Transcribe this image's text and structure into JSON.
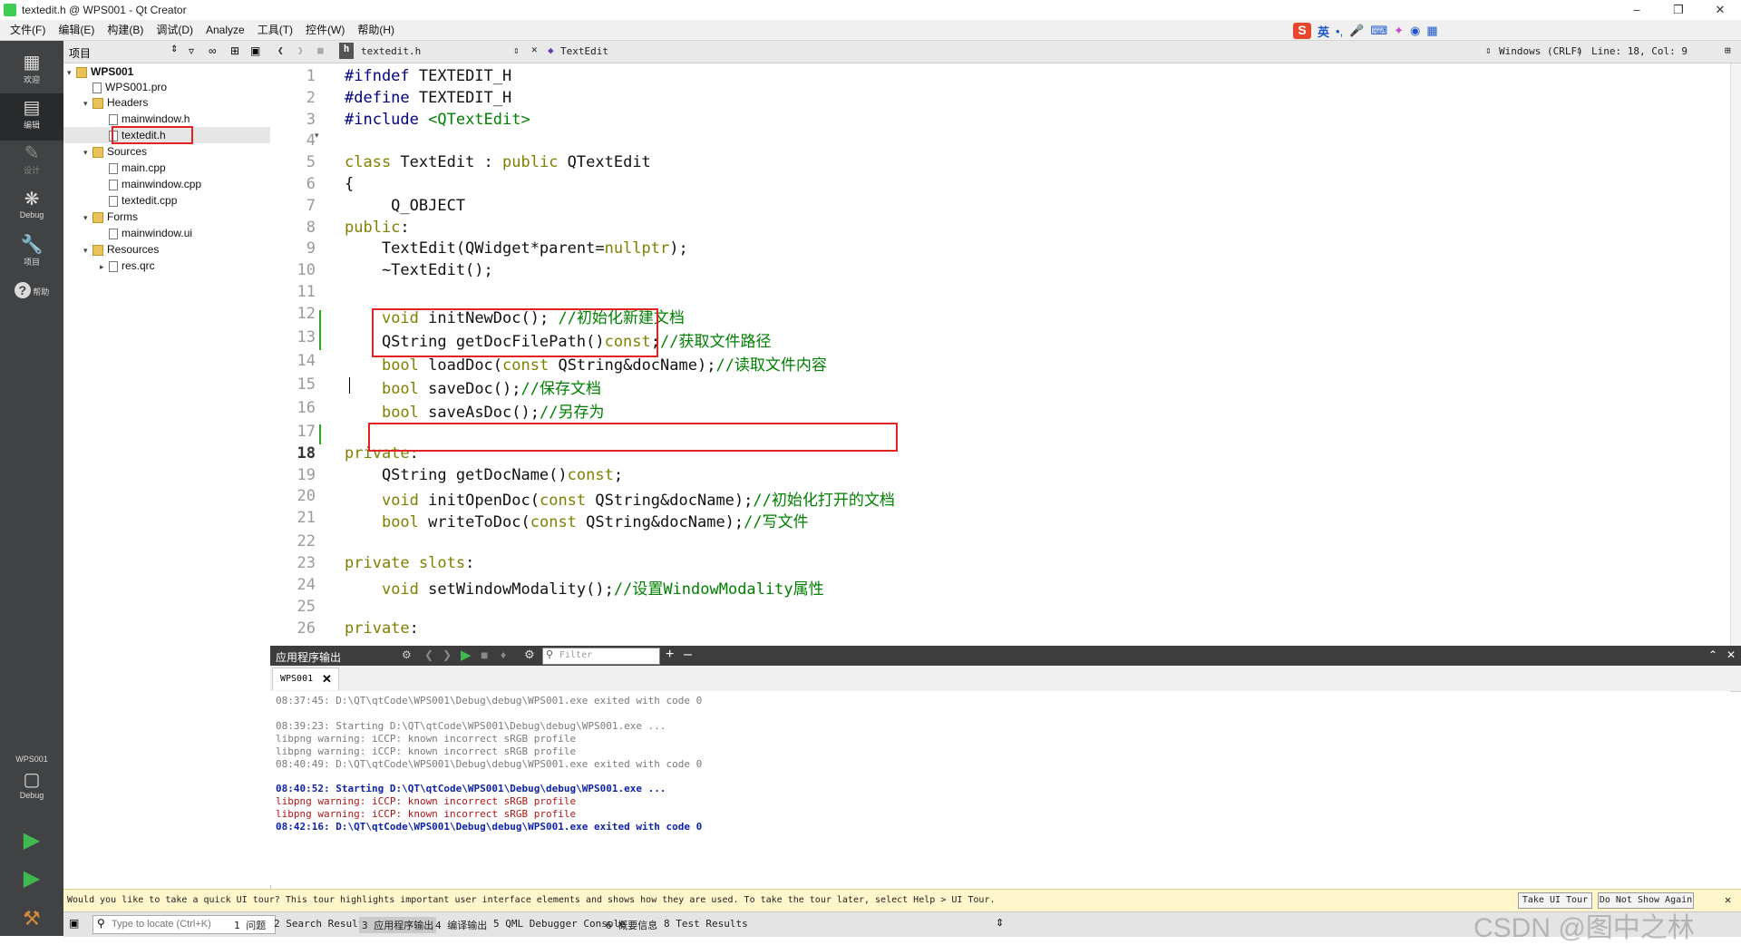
{
  "window": {
    "title": "textedit.h @ WPS001 - Qt Creator"
  },
  "menu": [
    "文件(F)",
    "编辑(E)",
    "构建(B)",
    "调试(D)",
    "Analyze",
    "工具(T)",
    "控件(W)",
    "帮助(H)"
  ],
  "ime": {
    "logo": "S",
    "lang": "英"
  },
  "modes": [
    {
      "label": "欢迎",
      "icon": "grid-icon"
    },
    {
      "label": "编辑",
      "icon": "edit-icon"
    },
    {
      "label": "设计",
      "icon": "pencil-icon"
    },
    {
      "label": "Debug",
      "icon": "bug-icon"
    },
    {
      "label": "项目",
      "icon": "wrench-icon"
    },
    {
      "label": "帮助",
      "icon": "help-icon"
    }
  ],
  "kit": {
    "project": "WPS001",
    "config": "Debug"
  },
  "project_panel": {
    "title": "项目",
    "tree": [
      {
        "label": "WPS001",
        "depth": 0,
        "kind": "project"
      },
      {
        "label": "WPS001.pro",
        "depth": 1,
        "kind": "file"
      },
      {
        "label": "Headers",
        "depth": 1,
        "kind": "folder"
      },
      {
        "label": "mainwindow.h",
        "depth": 2,
        "kind": "file"
      },
      {
        "label": "textedit.h",
        "depth": 2,
        "kind": "file"
      },
      {
        "label": "Sources",
        "depth": 1,
        "kind": "folder"
      },
      {
        "label": "main.cpp",
        "depth": 2,
        "kind": "file"
      },
      {
        "label": "mainwindow.cpp",
        "depth": 2,
        "kind": "file"
      },
      {
        "label": "textedit.cpp",
        "depth": 2,
        "kind": "file"
      },
      {
        "label": "Forms",
        "depth": 1,
        "kind": "folder"
      },
      {
        "label": "mainwindow.ui",
        "depth": 2,
        "kind": "file"
      },
      {
        "label": "Resources",
        "depth": 1,
        "kind": "folder"
      },
      {
        "label": "res.qrc",
        "depth": 2,
        "kind": "file"
      }
    ]
  },
  "editor": {
    "file": "textedit.h",
    "symbol": "TextEdit",
    "line_ending": "Windows (CRLF)",
    "position": "Line: 18, Col: 9",
    "current_line": 18,
    "lines": [
      {
        "n": 1,
        "segs": [
          {
            "t": "#ifndef ",
            "c": "pp"
          },
          {
            "t": "TEXTEDIT_H",
            "c": ""
          }
        ]
      },
      {
        "n": 2,
        "segs": [
          {
            "t": "#define ",
            "c": "pp"
          },
          {
            "t": "TEXTEDIT_H",
            "c": ""
          }
        ]
      },
      {
        "n": 3,
        "segs": [
          {
            "t": "#include ",
            "c": "pp"
          },
          {
            "t": "<QTextEdit>",
            "c": "inc"
          }
        ]
      },
      {
        "n": 4,
        "segs": []
      },
      {
        "n": 5,
        "segs": [
          {
            "t": "class ",
            "c": "kw"
          },
          {
            "t": "TextEdit : ",
            "c": ""
          },
          {
            "t": "public ",
            "c": "kw"
          },
          {
            "t": "QTextEdit",
            "c": ""
          }
        ]
      },
      {
        "n": 6,
        "segs": [
          {
            "t": "{",
            "c": ""
          }
        ]
      },
      {
        "n": 7,
        "segs": [
          {
            "t": "     Q_OBJECT",
            "c": ""
          }
        ]
      },
      {
        "n": 8,
        "segs": [
          {
            "t": "public",
            "c": "kw"
          },
          {
            "t": ":",
            "c": ""
          }
        ]
      },
      {
        "n": 9,
        "segs": [
          {
            "t": "    TextEdit(QWidget*parent=",
            "c": ""
          },
          {
            "t": "nullptr",
            "c": "kw"
          },
          {
            "t": ");",
            "c": ""
          }
        ]
      },
      {
        "n": 10,
        "segs": [
          {
            "t": "    ~TextEdit();",
            "c": ""
          }
        ]
      },
      {
        "n": 11,
        "segs": []
      },
      {
        "n": 12,
        "segs": [
          {
            "t": "    ",
            "c": ""
          },
          {
            "t": "void ",
            "c": "kw"
          },
          {
            "t": "initNewDoc(); ",
            "c": ""
          },
          {
            "t": "//初始化新建文档",
            "c": "cm"
          }
        ]
      },
      {
        "n": 13,
        "segs": [
          {
            "t": "    QString getDocFilePath()",
            "c": ""
          },
          {
            "t": "const",
            "c": "kw"
          },
          {
            "t": ";",
            "c": ""
          },
          {
            "t": "//获取文件路径",
            "c": "cm"
          }
        ]
      },
      {
        "n": 14,
        "segs": [
          {
            "t": "    ",
            "c": ""
          },
          {
            "t": "bool ",
            "c": "kw"
          },
          {
            "t": "loadDoc(",
            "c": ""
          },
          {
            "t": "const ",
            "c": "kw"
          },
          {
            "t": "QString&docName);",
            "c": ""
          },
          {
            "t": "//读取文件内容",
            "c": "cm"
          }
        ]
      },
      {
        "n": 15,
        "segs": [
          {
            "t": "    ",
            "c": ""
          },
          {
            "t": "bool ",
            "c": "kw"
          },
          {
            "t": "saveDoc();",
            "c": ""
          },
          {
            "t": "//保存文档",
            "c": "cm"
          }
        ]
      },
      {
        "n": 16,
        "segs": [
          {
            "t": "    ",
            "c": ""
          },
          {
            "t": "bool ",
            "c": "kw"
          },
          {
            "t": "saveAsDoc();",
            "c": ""
          },
          {
            "t": "//另存为",
            "c": "cm"
          }
        ]
      },
      {
        "n": 17,
        "segs": []
      },
      {
        "n": 18,
        "segs": [
          {
            "t": "private",
            "c": "kw"
          },
          {
            "t": ":",
            "c": ""
          }
        ]
      },
      {
        "n": 19,
        "segs": [
          {
            "t": "    QString getDocName()",
            "c": ""
          },
          {
            "t": "const",
            "c": "kw"
          },
          {
            "t": ";",
            "c": ""
          }
        ]
      },
      {
        "n": 20,
        "segs": [
          {
            "t": "    ",
            "c": ""
          },
          {
            "t": "void ",
            "c": "kw"
          },
          {
            "t": "initOpenDoc(",
            "c": ""
          },
          {
            "t": "const ",
            "c": "kw"
          },
          {
            "t": "QString&docName);",
            "c": ""
          },
          {
            "t": "//初始化打开的文档",
            "c": "cm"
          }
        ]
      },
      {
        "n": 21,
        "segs": [
          {
            "t": "    ",
            "c": ""
          },
          {
            "t": "bool ",
            "c": "kw"
          },
          {
            "t": "writeToDoc(",
            "c": ""
          },
          {
            "t": "const ",
            "c": "kw"
          },
          {
            "t": "QString&docName);",
            "c": ""
          },
          {
            "t": "//写文件",
            "c": "cm"
          }
        ]
      },
      {
        "n": 22,
        "segs": []
      },
      {
        "n": 23,
        "segs": [
          {
            "t": "private slots",
            "c": "kw"
          },
          {
            "t": ":",
            "c": ""
          }
        ]
      },
      {
        "n": 24,
        "segs": [
          {
            "t": "    ",
            "c": ""
          },
          {
            "t": "void ",
            "c": "kw"
          },
          {
            "t": "setWindowModality();",
            "c": ""
          },
          {
            "t": "//设置WindowModality属性",
            "c": "cm"
          }
        ]
      },
      {
        "n": 25,
        "segs": []
      },
      {
        "n": 26,
        "segs": [
          {
            "t": "private",
            "c": "kw"
          },
          {
            "t": ":",
            "c": ""
          }
        ]
      }
    ]
  },
  "output_pane": {
    "title": "应用程序输出",
    "filter_placeholder": "Filter",
    "tab": "WPS001",
    "lines": [
      {
        "t": "08:37:45: D:\\QT\\qtCode\\WPS001\\Debug\\debug\\WPS001.exe exited with code 0",
        "s": "og"
      },
      {
        "t": "",
        "s": "og"
      },
      {
        "t": "08:39:23: Starting D:\\QT\\qtCode\\WPS001\\Debug\\debug\\WPS001.exe ...",
        "s": "og"
      },
      {
        "t": "libpng warning: iCCP: known incorrect sRGB profile",
        "s": "og"
      },
      {
        "t": "libpng warning: iCCP: known incorrect sRGB profile",
        "s": "og"
      },
      {
        "t": "08:40:49: D:\\QT\\qtCode\\WPS001\\Debug\\debug\\WPS001.exe exited with code 0",
        "s": "og"
      },
      {
        "t": "",
        "s": "og"
      },
      {
        "t": "08:40:52: Starting D:\\QT\\qtCode\\WPS001\\Debug\\debug\\WPS001.exe ...",
        "s": "ob"
      },
      {
        "t": "libpng warning: iCCP: known incorrect sRGB profile",
        "s": "orr"
      },
      {
        "t": "libpng warning: iCCP: known incorrect sRGB profile",
        "s": "orr"
      },
      {
        "t": "08:42:16: D:\\QT\\qtCode\\WPS001\\Debug\\debug\\WPS001.exe exited with code 0",
        "s": "ob"
      }
    ]
  },
  "tour": {
    "message": "Would you like to take a quick UI tour? This tour highlights important user interface elements and shows how they are used. To take the tour later, select Help > UI Tour.",
    "take_btn": "Take UI Tour",
    "dont_btn": "Do Not Show Again"
  },
  "statusbar": {
    "locate_placeholder": "Type to locate (Ctrl+K)",
    "tabs": [
      "1 问题",
      "2 Search Results",
      "3 应用程序输出",
      "4 编译输出",
      "5 QML Debugger Console",
      "6 概要信息",
      "8 Test Results"
    ]
  },
  "watermark": "CSDN @图中之林"
}
